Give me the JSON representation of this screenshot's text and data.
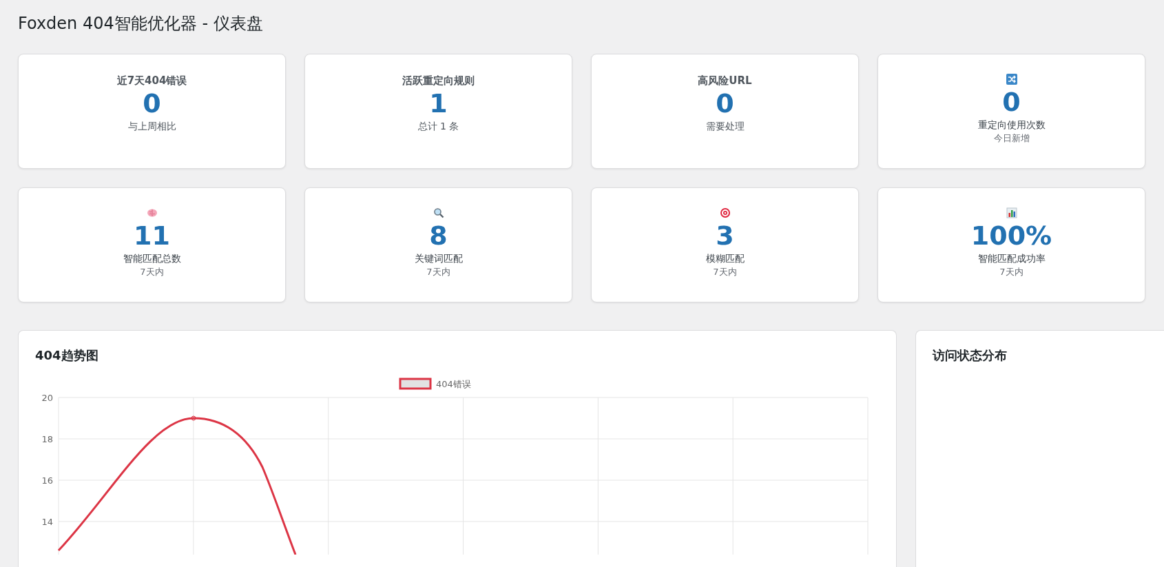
{
  "page_title": "Foxden 404智能优化器 - 仪表盘",
  "stat_cards": [
    {
      "kind": "headline",
      "title": "近7天404错误",
      "value": "0",
      "caption": "与上周相比"
    },
    {
      "kind": "headline",
      "title": "活跃重定向规则",
      "value": "1",
      "caption": "总计 1 条"
    },
    {
      "kind": "headline",
      "title": "高风险URL",
      "value": "0",
      "caption": "需要处理"
    },
    {
      "kind": "icon",
      "value": "0",
      "caption": "重定向使用次数",
      "note": "今日新增"
    },
    {
      "kind": "icon",
      "value": "11",
      "caption": "智能匹配总数",
      "note": "7天内"
    },
    {
      "kind": "icon",
      "value": "8",
      "caption": "关键词匹配",
      "note": "7天内"
    },
    {
      "kind": "icon",
      "value": "3",
      "caption": "模糊匹配",
      "note": "7天内"
    },
    {
      "kind": "icon",
      "value": "100%",
      "caption": "智能匹配成功率",
      "note": "7天内"
    }
  ],
  "trend_panel": {
    "title": "404趋势图",
    "legend": {
      "label": "404错误",
      "color": "#dc3545"
    },
    "y_axis_labels": [
      "20",
      "18",
      "16",
      "14"
    ]
  },
  "status_panel": {
    "title": "访问状态分布"
  }
}
